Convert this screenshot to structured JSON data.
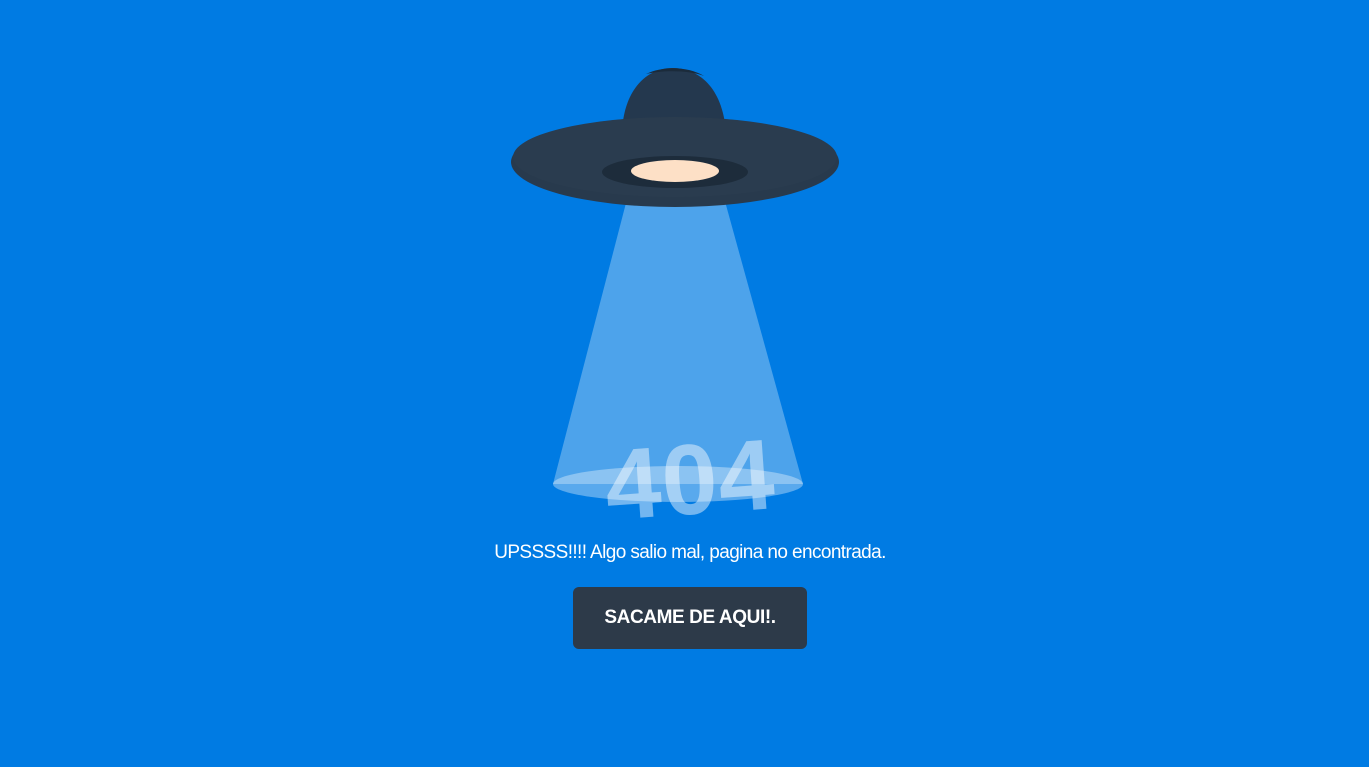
{
  "error_code": "404",
  "message": "UPSSSS!!!! Algo salio mal, pagina no encontrada.",
  "button_label": "SACAME DE AQUI!.",
  "colors": {
    "background": "#007be3",
    "ufo_dark": "#283a4d",
    "button_bg": "#2d3a49",
    "ufo_light": "#fde0c6"
  },
  "icons": [
    "ufo-icon"
  ]
}
